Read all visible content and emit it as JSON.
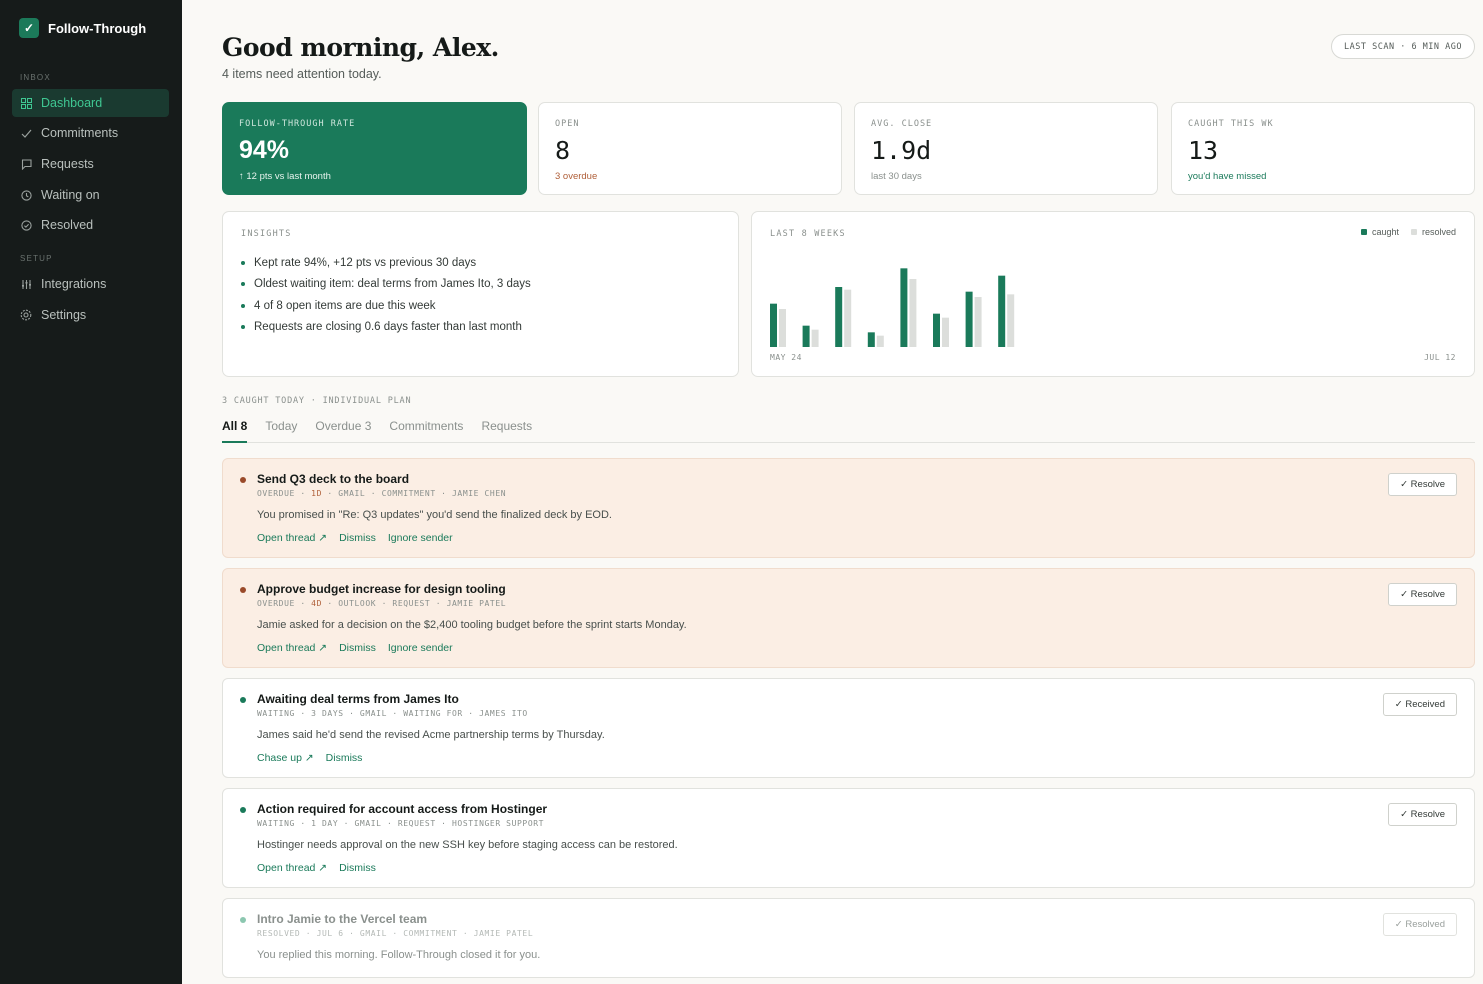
{
  "sidebar": {
    "brand": "Follow-Through",
    "sections": {
      "inbox": "INBOX",
      "setup": "SETUP"
    },
    "items": [
      {
        "label": "Dashboard",
        "icon": "grid-icon"
      },
      {
        "label": "Commitments",
        "icon": "check-icon"
      },
      {
        "label": "Requests",
        "icon": "message-icon"
      },
      {
        "label": "Waiting on",
        "icon": "clock-icon"
      },
      {
        "label": "Resolved",
        "icon": "check-circle-icon"
      },
      {
        "label": "Integrations",
        "icon": "sliders-icon"
      },
      {
        "label": "Settings",
        "icon": "gear-icon"
      }
    ]
  },
  "header": {
    "greeting": "Good morning, Alex.",
    "subtitle": "4 items need attention today.",
    "scan": "LAST SCAN · 6 MIN AGO"
  },
  "stats": [
    {
      "label": "FOLLOW-THROUGH RATE",
      "value": "94%",
      "sub": "↑ 12 pts vs last month"
    },
    {
      "label": "OPEN",
      "value": "8",
      "sub": "3 overdue"
    },
    {
      "label": "AVG. CLOSE",
      "value": "1.9d",
      "sub": "last 30 days"
    },
    {
      "label": "CAUGHT THIS WK",
      "value": "13",
      "sub": "you'd have missed"
    }
  ],
  "insights": {
    "label": "INSIGHTS",
    "items": [
      "Kept rate 94%, +12 pts vs previous 30 days",
      "Oldest waiting item: deal terms from James Ito, 3 days",
      "4 of 8 open items are due this week",
      "Requests are closing 0.6 days faster than last month"
    ]
  },
  "chart": {
    "label": "LAST 8 WEEKS",
    "start_label": "MAY 24",
    "end_label": "JUL 12",
    "colors": {
      "caught": "#1a7a5a",
      "resolved": "#dcdedb"
    }
  },
  "chart_data": {
    "type": "bar",
    "categories": [
      "1",
      "2",
      "3",
      "4",
      "5",
      "6",
      "7",
      "8"
    ],
    "series": [
      {
        "name": "caught",
        "values": [
          6.5,
          3.2,
          9.0,
          2.2,
          11.8,
          5.0,
          8.3,
          10.7
        ]
      },
      {
        "name": "resolved",
        "values": [
          5.7,
          2.6,
          8.6,
          1.7,
          10.2,
          4.4,
          7.5,
          7.9
        ]
      }
    ],
    "ylim": [
      0,
      12
    ]
  },
  "list": {
    "caught_line": "3 CAUGHT TODAY · INDIVIDUAL PLAN",
    "tabs": [
      "All 8",
      "Today",
      "Overdue 3",
      "Commitments",
      "Requests"
    ],
    "items": [
      {
        "status": "overdue",
        "title": "Send Q3 deck to the board",
        "meta_pre": "OVERDUE · ",
        "meta_hl": "1D",
        "meta_post": " · GMAIL · COMMITMENT · JAMIE CHEN",
        "desc": "You promised in \"Re: Q3 updates\" you'd send the finalized deck by EOD.",
        "actions": [
          "Open thread ↗",
          "Dismiss",
          "Ignore sender"
        ],
        "button": "✓ Resolve",
        "dot_color": "#9a4a2a"
      },
      {
        "status": "overdue",
        "title": "Approve budget increase for design tooling",
        "meta_pre": "OVERDUE · ",
        "meta_hl": "4D",
        "meta_post": " · OUTLOOK · REQUEST · JAMIE PATEL",
        "desc": "Jamie asked for a decision on the $2,400 tooling budget before the sprint starts Monday.",
        "actions": [
          "Open thread ↗",
          "Dismiss",
          "Ignore sender"
        ],
        "button": "✓ Resolve",
        "dot_color": "#9a4a2a"
      },
      {
        "status": "waiting",
        "title": "Awaiting deal terms from James Ito",
        "meta_pre": "WAITING · 3 DAYS · GMAIL · WAITING FOR · JAMES ITO",
        "meta_hl": "",
        "meta_post": "",
        "desc": "James said he'd send the revised Acme partnership terms by Thursday.",
        "actions": [
          "Chase up ↗",
          "Dismiss"
        ],
        "button": "✓ Received",
        "dot_color": "#1a7a5a"
      },
      {
        "status": "waiting",
        "title": "Action required for account access from Hostinger",
        "meta_pre": "WAITING · 1 DAY · GMAIL · REQUEST · HOSTINGER SUPPORT",
        "meta_hl": "",
        "meta_post": "",
        "desc": "Hostinger needs approval on the new SSH key before staging access can be restored.",
        "actions": [
          "Open thread ↗",
          "Dismiss"
        ],
        "button": "✓ Resolve",
        "dot_color": "#1a7a5a"
      },
      {
        "status": "resolved",
        "title": "Intro Jamie to the Vercel team",
        "meta_pre": "RESOLVED · JUL 6 · GMAIL · COMMITMENT · JAMIE PATEL",
        "meta_hl": "",
        "meta_post": "",
        "desc": "You replied this morning. Follow-Through closed it for you.",
        "actions": [],
        "button": "✓ Resolved",
        "dot_color": "#8cc7b0"
      }
    ]
  }
}
